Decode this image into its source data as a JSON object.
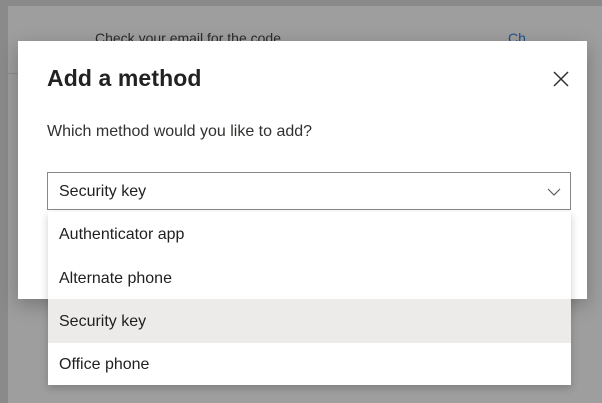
{
  "background": {
    "left_text": "Check your email for the code",
    "right_text": "Ch"
  },
  "dialog": {
    "title": "Add a method",
    "prompt": "Which method would you like to add?",
    "close_icon": "close-icon",
    "select": {
      "value": "Security key",
      "chevron_icon": "chevron-down-icon"
    },
    "options": [
      {
        "label": "Authenticator app",
        "selected": false
      },
      {
        "label": "Alternate phone",
        "selected": false
      },
      {
        "label": "Security key",
        "selected": true
      },
      {
        "label": "Office phone",
        "selected": false
      }
    ]
  },
  "colors": {
    "selected_option_bg": "#edebe9",
    "field_border": "#8a8886",
    "text": "#201f1e"
  }
}
